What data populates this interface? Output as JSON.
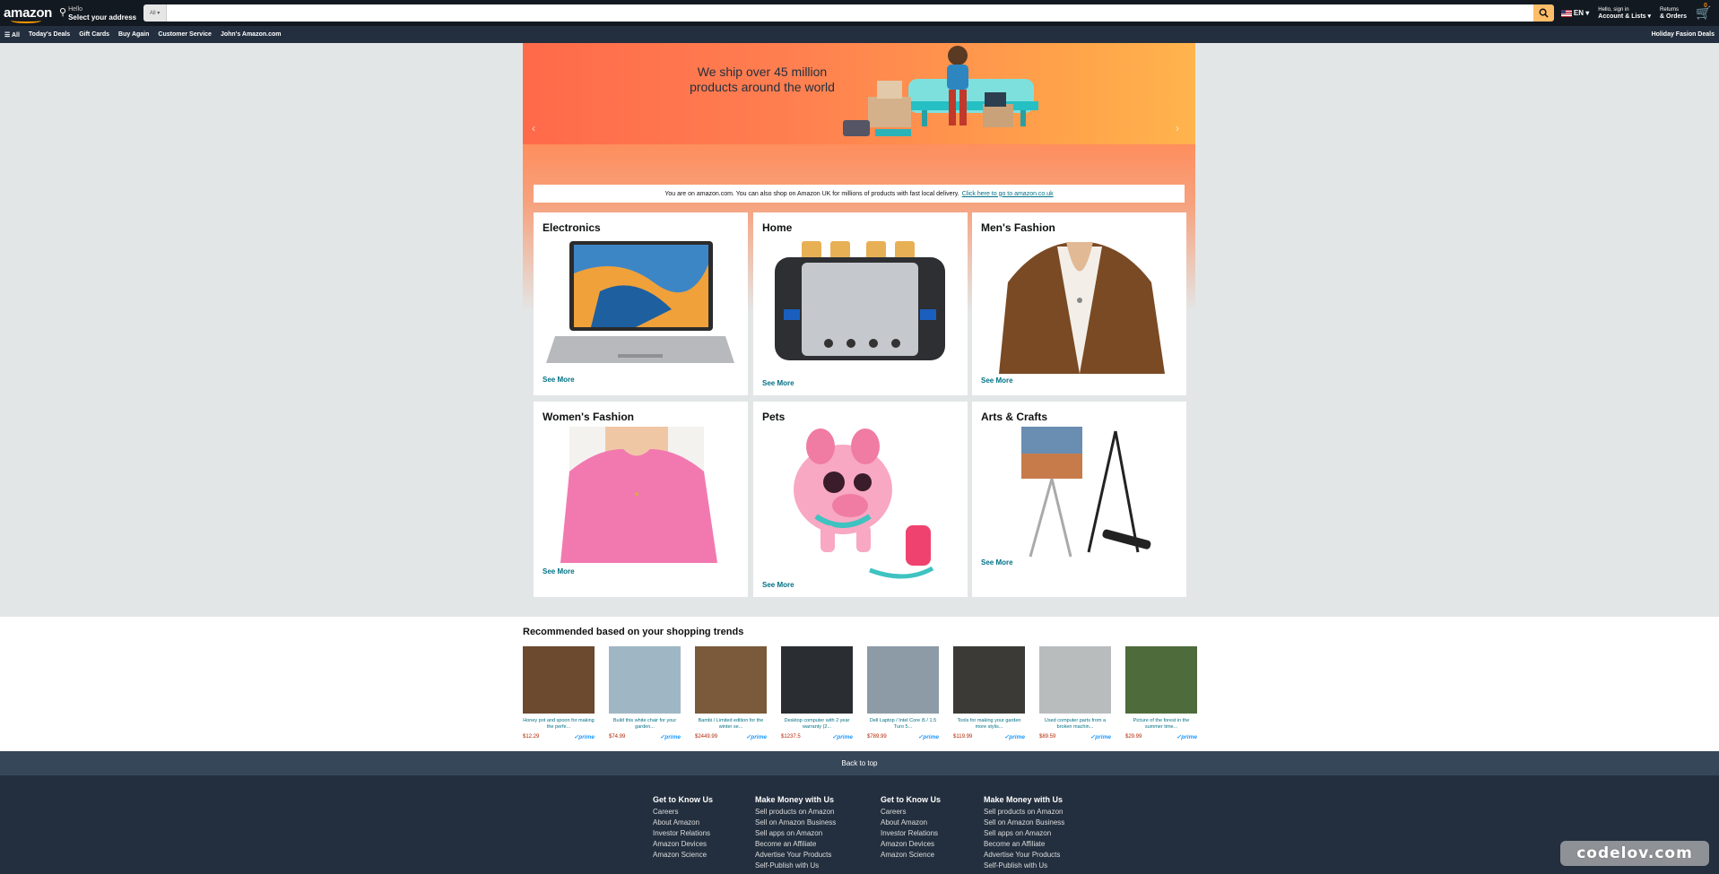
{
  "header": {
    "logo": "amazon",
    "address_small": "Hello",
    "address_big": "Select your address",
    "search_category": "All",
    "search_placeholder": "",
    "language": "EN",
    "account_small": "Hello, sign in",
    "account_big": "Account & Lists",
    "returns_small": "Returns",
    "returns_big": "& Orders",
    "cart_count": "0"
  },
  "nav": {
    "all": "All",
    "items": [
      "Today's Deals",
      "Gift Cards",
      "Buy Again",
      "Customer Service",
      "John's Amazon.com"
    ],
    "right": "Holiday Fasion Deals"
  },
  "hero": {
    "line1": "We ship over 45 million",
    "line2": "products around the world",
    "prev": "‹",
    "next": "›"
  },
  "notice": {
    "text": "You are on amazon.com. You can also shop on Amazon UK for millions of products with fast local delivery.",
    "link": "Click here to go to amazon.co.uk"
  },
  "cards": [
    {
      "title": "Electronics",
      "see": "See More"
    },
    {
      "title": "Home",
      "see": "See More"
    },
    {
      "title": "Men's Fashion",
      "see": "See More"
    },
    {
      "title": "Women's Fashion",
      "see": "See More"
    },
    {
      "title": "Pets",
      "see": "See More"
    },
    {
      "title": "Arts & Crafts",
      "see": "See More"
    }
  ],
  "reco": {
    "title": "Recommended based on your shopping trends",
    "products": [
      {
        "caption": "Honey pot and spoon for making the perfe...",
        "price": "$12.29",
        "color": "#6b4a2f"
      },
      {
        "caption": "Build this white chair for your garden...",
        "price": "$74.99",
        "color": "#9fb7c4"
      },
      {
        "caption": "Bambi / Limited edition for the winter se...",
        "price": "$2449.99",
        "color": "#7a5a3a"
      },
      {
        "caption": "Desktop computer with 2 year warranty (2...",
        "price": "$1237.5",
        "color": "#2a2e33"
      },
      {
        "caption": "Dell Laptop / Intel Core i5 / 1.5 Turo 5...",
        "price": "$789.99",
        "color": "#8c9ba6"
      },
      {
        "caption": "Tools for making your garden more stylis...",
        "price": "$119.99",
        "color": "#3b3a36"
      },
      {
        "caption": "Used computer parts from a broken machin...",
        "price": "$89.59",
        "color": "#b9bcbd"
      },
      {
        "caption": "Picture of the forest in the summer time...",
        "price": "$29.99",
        "color": "#4d6b3b"
      }
    ],
    "prime": "✓prime"
  },
  "back_to_top": "Back to top",
  "footer": {
    "columns": [
      {
        "title": "Get to Know Us",
        "links": [
          "Careers",
          "About Amazon",
          "Investor Relations",
          "Amazon Devices",
          "Amazon Science"
        ]
      },
      {
        "title": "Make Money with Us",
        "links": [
          "Sell products on Amazon",
          "Sell on Amazon Business",
          "Sell apps on Amazon",
          "Become an Affiliate",
          "Advertise Your Products",
          "Self-Publish with Us"
        ]
      },
      {
        "title": "Get to Know Us",
        "links": [
          "Careers",
          "About Amazon",
          "Investor Relations",
          "Amazon Devices",
          "Amazon Science"
        ]
      },
      {
        "title": "Make Money with Us",
        "links": [
          "Sell products on Amazon",
          "Sell on Amazon Business",
          "Sell apps on Amazon",
          "Become an Affiliate",
          "Advertise Your Products",
          "Self-Publish with Us"
        ]
      }
    ]
  },
  "watermark": "codelov.com"
}
